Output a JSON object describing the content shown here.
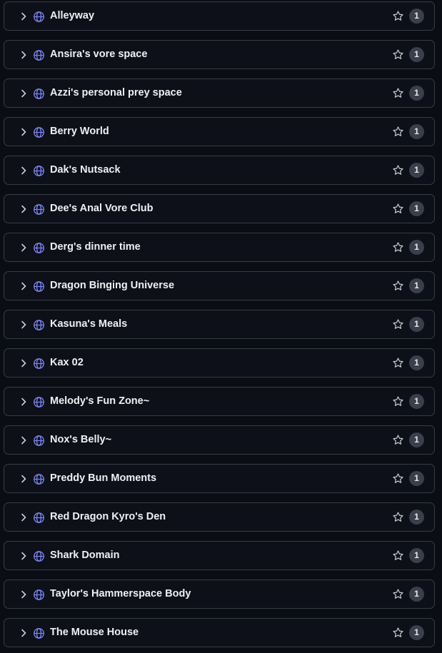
{
  "colors": {
    "background": "#0b0d14",
    "row_border": "#373c48",
    "globe_icon": "#7d84f0",
    "text": "#eef0f5",
    "badge_bg": "#3a3f4b"
  },
  "items": [
    {
      "label": "Alleyway",
      "count": "1",
      "icon": "globe-icon"
    },
    {
      "label": "Ansira's vore space",
      "count": "1",
      "icon": "globe-icon"
    },
    {
      "label": "Azzi's personal prey space",
      "count": "1",
      "icon": "globe-icon"
    },
    {
      "label": "Berry World",
      "count": "1",
      "icon": "globe-icon"
    },
    {
      "label": "Dak's Nutsack",
      "count": "1",
      "icon": "globe-icon"
    },
    {
      "label": "Dee's Anal Vore Club",
      "count": "1",
      "icon": "globe-icon"
    },
    {
      "label": "Derg's dinner time",
      "count": "1",
      "icon": "globe-icon"
    },
    {
      "label": "Dragon Binging Universe",
      "count": "1",
      "icon": "globe-icon"
    },
    {
      "label": "Kasuna's Meals",
      "count": "1",
      "icon": "globe-icon"
    },
    {
      "label": "Kax 02",
      "count": "1",
      "icon": "globe-icon"
    },
    {
      "label": "Melody's Fun Zone~",
      "count": "1",
      "icon": "globe-icon"
    },
    {
      "label": "Nox's Belly~",
      "count": "1",
      "icon": "globe-icon"
    },
    {
      "label": "Preddy Bun Moments",
      "count": "1",
      "icon": "globe-icon"
    },
    {
      "label": "Red Dragon Kyro's Den",
      "count": "1",
      "icon": "globe-icon"
    },
    {
      "label": "Shark Domain",
      "count": "1",
      "icon": "globe-icon"
    },
    {
      "label": "Taylor's Hammerspace Body",
      "count": "1",
      "icon": "globe-icon"
    },
    {
      "label": "The Mouse House",
      "count": "1",
      "icon": "globe-icon"
    }
  ]
}
